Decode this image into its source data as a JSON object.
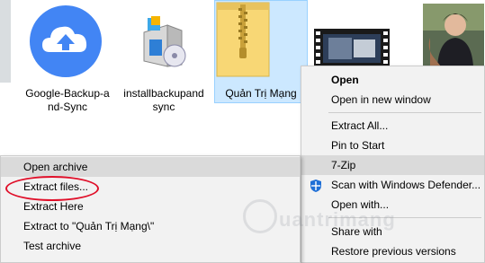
{
  "files": [
    {
      "label": "Google-Backup-a\nnd-Sync",
      "icon": "google-backup-cloud-icon"
    },
    {
      "label": "installbackupand\nsync",
      "icon": "installer-box-icon"
    },
    {
      "label": "Quản Trị Mạng",
      "icon": "zip-folder-icon"
    },
    {
      "label": "",
      "icon": "video-thumbnail"
    },
    {
      "label": "",
      "icon": "photo-thumbnail"
    }
  ],
  "context_menu": {
    "items": [
      {
        "label": "Open",
        "bold": true
      },
      {
        "label": "Open in new window"
      },
      {
        "label": "Extract All..."
      },
      {
        "label": "Pin to Start"
      },
      {
        "label": "7-Zip",
        "has_submenu": true
      },
      {
        "label": "Scan with Windows Defender...",
        "icon": "windows-defender-icon"
      },
      {
        "label": "Open with..."
      },
      {
        "label": "Share with",
        "has_submenu": true
      },
      {
        "label": "Restore previous versions"
      }
    ]
  },
  "zip_submenu": {
    "items": [
      {
        "label": "Open archive"
      },
      {
        "label": "Extract files..."
      },
      {
        "label": "Extract Here"
      },
      {
        "label": "Extract to \"Quản Trị Mạng\\\""
      },
      {
        "label": "Test archive"
      }
    ]
  },
  "watermark": "uantrimang",
  "colors": {
    "selection_fill": "#cce8ff",
    "menu_bg": "#f2f2f2",
    "menu_highlight": "#dadada",
    "annotation_red": "#e0102a",
    "google_blue": "#4285f4",
    "folder_yellow": "#f8d775"
  }
}
